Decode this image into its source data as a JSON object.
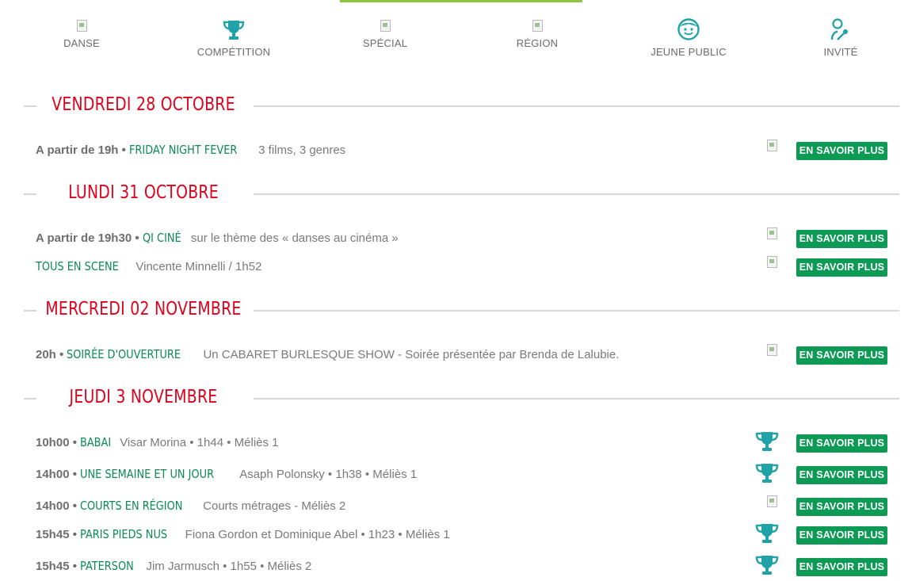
{
  "categories": [
    {
      "label": "DANSE",
      "icon": "broken-image-icon"
    },
    {
      "label": "COMPÉTITION",
      "icon": "trophy-icon"
    },
    {
      "label": "SPÉCIAL",
      "icon": "broken-image-icon"
    },
    {
      "label": "RÉGION",
      "icon": "broken-image-icon"
    },
    {
      "label": "JEUNE PUBLIC",
      "icon": "child-face-icon"
    },
    {
      "label": "INVITÉ",
      "icon": "microphone-icon"
    }
  ],
  "accent": "#8cc63f",
  "date_color": "#e2001a",
  "film_color": "#0c8a54",
  "button_color": "#0c9a55",
  "more_label": "EN SAVOIR PLUS",
  "days": [
    {
      "title": "VENDREDI 28 OCTOBRE",
      "events": [
        {
          "time": "A partir de 19h",
          "film": "FRIDAY NIGHT FEVER",
          "desc": "3 films, 3 genres",
          "icon": "broken-image-icon"
        }
      ]
    },
    {
      "title": "LUNDI 31 OCTOBRE",
      "events": [
        {
          "time": "A partir de 19h30",
          "film": "QI CINÉ",
          "desc": "sur le thème des « danses au cinéma »",
          "icon": "broken-image-icon"
        },
        {
          "time": "",
          "film": "TOUS EN SCENE",
          "desc": "Vincente Minnelli / 1h52",
          "icon": "broken-image-icon"
        }
      ]
    },
    {
      "title": "MERCREDI 02 NOVEMBRE",
      "events": [
        {
          "time": "20h",
          "film": "SOIRÉE D'OUVERTURE",
          "desc": "Un CABARET BURLESQUE SHOW - Soirée présentée par Brenda de Lalubie.",
          "icon": "broken-image-icon"
        }
      ]
    },
    {
      "title": "JEUDI 3 NOVEMBRE",
      "events": [
        {
          "time": "10h00",
          "film": "BABAI",
          "desc": "Visar Morina • 1h44 • Méliès 1",
          "icon": "trophy-icon"
        },
        {
          "time": "14h00",
          "film": "UNE SEMAINE ET UN JOUR",
          "desc": "Asaph Polonsky • 1h38 • Méliès 1",
          "icon": "trophy-icon"
        },
        {
          "time": "14h00",
          "film": "COURTS EN RÉGION",
          "desc": "Courts métrages - Méliès 2",
          "icon": "broken-image-icon"
        },
        {
          "time": "15h45",
          "film": "PARIS PIEDS NUS",
          "desc": "Fiona Gordon et Dominique Abel • 1h23 • Méliès 1",
          "icon": "trophy-icon"
        },
        {
          "time": "15h45",
          "film": "PATERSON",
          "desc": "Jim Jarmusch • 1h55 • Méliès 2",
          "icon": "trophy-icon"
        }
      ]
    }
  ]
}
